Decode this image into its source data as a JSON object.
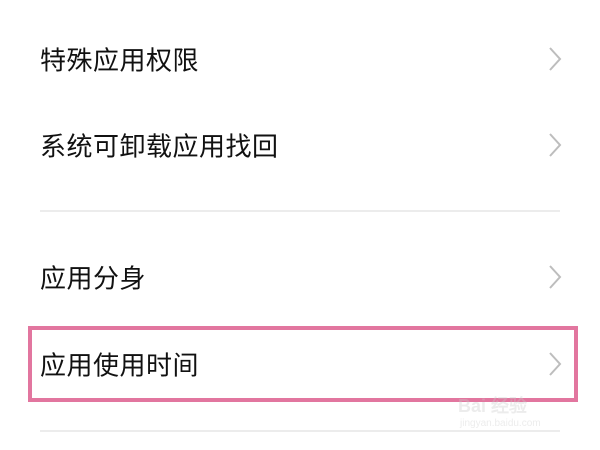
{
  "settings_list": {
    "items": [
      {
        "label": "特殊应用权限"
      },
      {
        "label": "系统可卸载应用找回"
      },
      {
        "label": "应用分身"
      },
      {
        "label": "应用使用时间"
      }
    ]
  },
  "highlight_color": "#e2769f",
  "icons": {
    "chevron": "chevron-right-icon"
  },
  "watermark": {
    "brand": "Bai 经验",
    "url": "jingyan.baidu.com"
  }
}
